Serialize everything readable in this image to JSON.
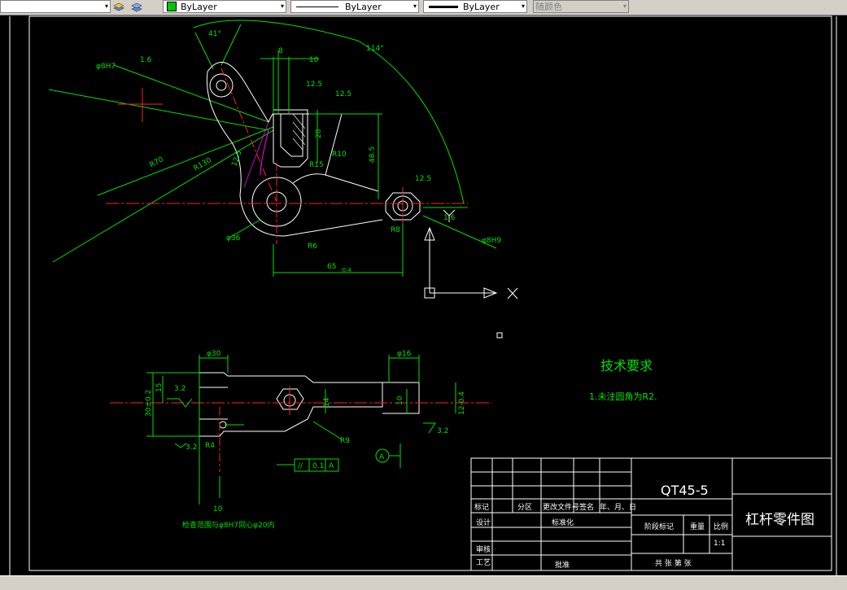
{
  "toolbar": {
    "layer_arrow": "▾",
    "color_label": "ByLayer",
    "linetype_label": "ByLayer",
    "lineweight_label": "ByLayer",
    "plotstyle_label": "随颜色",
    "color_swatch": "#00c800"
  },
  "drawing": {
    "dim_41": "41°",
    "dim_114": "114°",
    "dim_8": "8",
    "dim_10": "10",
    "dim_12_5_a": "12.5",
    "dim_12_5_b": "12.5",
    "dim_12_5_c": "12.5",
    "dim_1_6_a": "1.6",
    "dim_1_6_b": "1.6",
    "phi7_a": "φ8H7",
    "phi7_b": "φ8H9",
    "phi36": "φ36",
    "r10": "R10",
    "r130": "R130",
    "r70": "R70",
    "r15": "R15",
    "r6": "R6",
    "r8": "R8",
    "r9": "R9",
    "dim_65": "65",
    "dim_65_tol": "-0.4",
    "dim_48_5": "48.5",
    "dim_20": "20",
    "axis_x": "X",
    "axis_y": "Y",
    "dim_phi30": "φ30",
    "dim_phi16": "φ16",
    "dim_3_2_a": "3.2",
    "dim_3_2_b": "3.2",
    "dim_3_2_c": "3.2",
    "dim_15": "15",
    "dim_30": "30±0.2",
    "dim_14": "14",
    "dim_10b": "10",
    "dim_12": "12-0.4",
    "dim_r4": "R4",
    "dim_10_bottom": "10",
    "tol_symbol": "//",
    "tol_value": "0.1",
    "tol_datum": "A",
    "datum_a": "A",
    "note_bottom": "检查范围与φ8H7同心φ20内",
    "tech_title": "技术要求",
    "tech_item": "1.未注圆角为R2."
  },
  "title_block": {
    "part_no": "QT45-5",
    "part_name": "杠杆零件图",
    "header_mark": "标记",
    "header_zone": "分区",
    "header_docno": "更改文件号",
    "header_sign": "签名",
    "header_date": "年、月、日",
    "row_design": "设计",
    "row_standard": "标准化",
    "row_stage": "阶段标记",
    "row_weight": "重量",
    "row_scale": "比例",
    "scale_value": "1:1",
    "row_review": "审核",
    "row_process": "工艺",
    "row_approve": "批准",
    "sheets": "共   张   第   张"
  }
}
